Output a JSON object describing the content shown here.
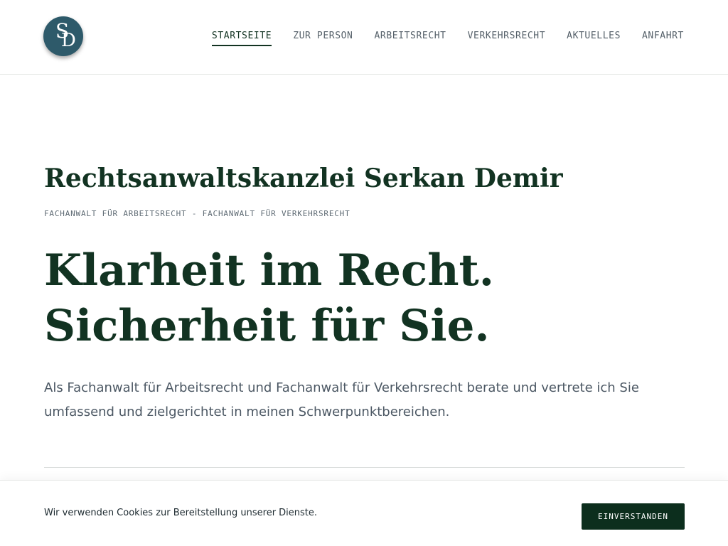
{
  "header": {
    "logo": {
      "letter_1": "S",
      "letter_2": "D"
    },
    "nav": [
      {
        "label": "STARTSEITE",
        "active": true
      },
      {
        "label": "ZUR PERSON",
        "active": false
      },
      {
        "label": "ARBEITSRECHT",
        "active": false
      },
      {
        "label": "VERKEHRSRECHT",
        "active": false
      },
      {
        "label": "AKTUELLES",
        "active": false
      },
      {
        "label": "ANFAHRT",
        "active": false
      }
    ]
  },
  "hero": {
    "firm_name": "Rechtsanwaltskanzlei Serkan Demir",
    "subtitle": "FACHANWALT FÜR ARBEITSRECHT - FACHANWALT FÜR VERKEHRSRECHT",
    "headline_line_1": "Klarheit im Recht.",
    "headline_line_2": "Sicherheit für Sie.",
    "intro": "Als Fachanwalt für Arbeitsrecht und Fachanwalt für Verkehrsrecht berate und vertrete ich Sie umfassend und zielgerichtet in meinen Schwerpunktbereichen."
  },
  "cookie_banner": {
    "text": "Wir verwenden Cookies zur Bereitstellung unserer Dienste.",
    "button_label": "EINVERSTANDEN"
  },
  "colors": {
    "brand_dark_green": "#123322",
    "logo_teal": "#2e5a6a",
    "button_bg": "#0c2e1d",
    "body_text": "#4b5763"
  }
}
